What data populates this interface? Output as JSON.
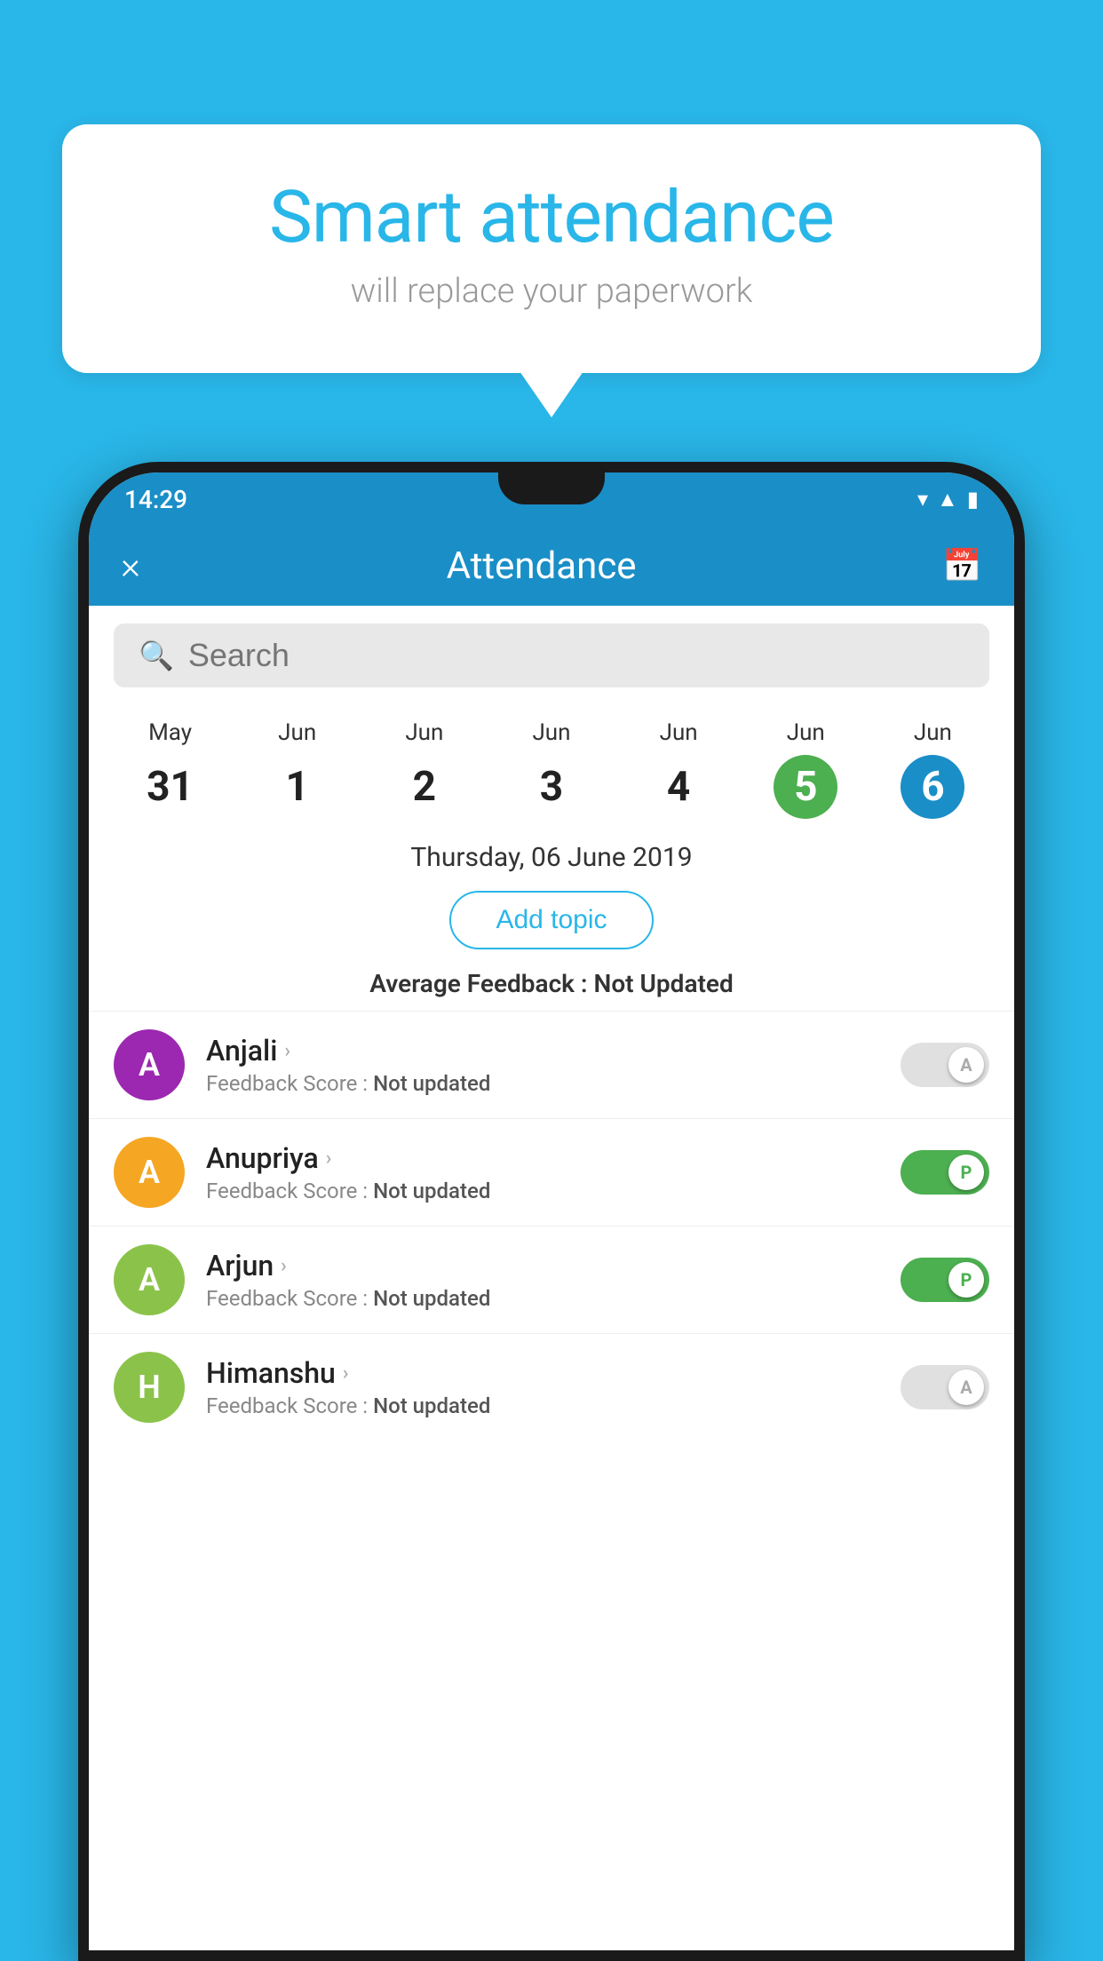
{
  "background_color": "#29b6e8",
  "bubble": {
    "title": "Smart attendance",
    "subtitle": "will replace your paperwork"
  },
  "status_bar": {
    "time": "14:29"
  },
  "header": {
    "title": "Attendance",
    "close_label": "×",
    "calendar_icon": "calendar-icon"
  },
  "search": {
    "placeholder": "Search"
  },
  "calendar": {
    "days": [
      {
        "month": "May",
        "date": "31",
        "state": "normal"
      },
      {
        "month": "Jun",
        "date": "1",
        "state": "normal"
      },
      {
        "month": "Jun",
        "date": "2",
        "state": "normal"
      },
      {
        "month": "Jun",
        "date": "3",
        "state": "normal"
      },
      {
        "month": "Jun",
        "date": "4",
        "state": "normal"
      },
      {
        "month": "Jun",
        "date": "5",
        "state": "today"
      },
      {
        "month": "Jun",
        "date": "6",
        "state": "selected"
      }
    ]
  },
  "selected_date": "Thursday, 06 June 2019",
  "add_topic_label": "Add topic",
  "average_feedback_label": "Average Feedback : ",
  "average_feedback_value": "Not Updated",
  "students": [
    {
      "name": "Anjali",
      "feedback_label": "Feedback Score : ",
      "feedback_value": "Not updated",
      "avatar_letter": "A",
      "avatar_color": "#9c27b0",
      "toggle_state": "off",
      "toggle_letter": "A"
    },
    {
      "name": "Anupriya",
      "feedback_label": "Feedback Score : ",
      "feedback_value": "Not updated",
      "avatar_letter": "A",
      "avatar_color": "#f5a623",
      "toggle_state": "on",
      "toggle_letter": "P"
    },
    {
      "name": "Arjun",
      "feedback_label": "Feedback Score : ",
      "feedback_value": "Not updated",
      "avatar_letter": "A",
      "avatar_color": "#8bc34a",
      "toggle_state": "on",
      "toggle_letter": "P"
    },
    {
      "name": "Himanshu",
      "feedback_label": "Feedback Score : ",
      "feedback_value": "Not updated",
      "avatar_letter": "H",
      "avatar_color": "#8bc34a",
      "toggle_state": "off",
      "toggle_letter": "A"
    }
  ]
}
